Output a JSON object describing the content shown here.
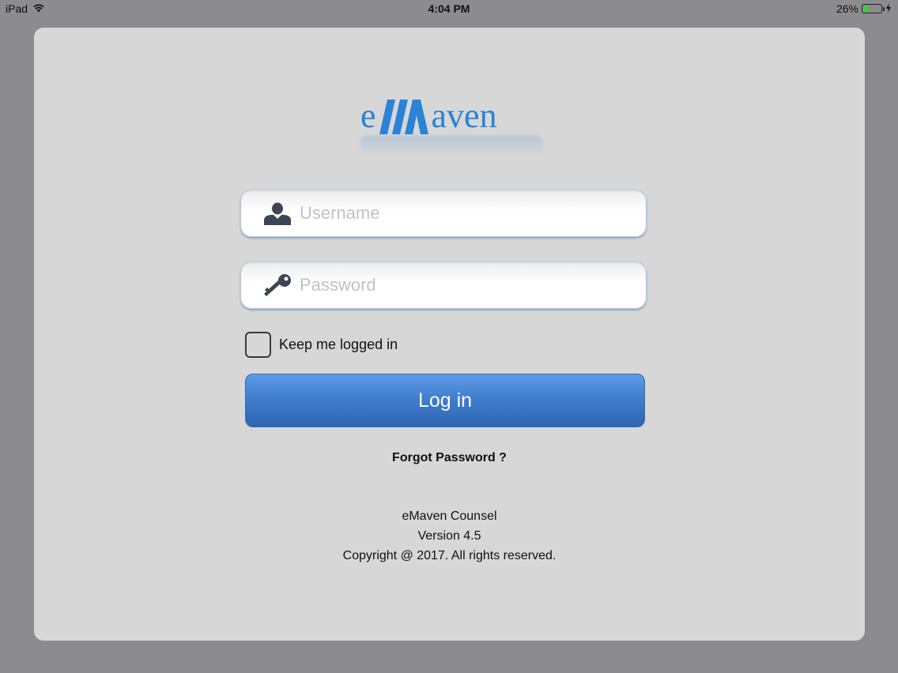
{
  "status_bar": {
    "device": "iPad",
    "time": "4:04 PM",
    "battery": "26%",
    "battery_level": 0.26
  },
  "logo": {
    "prefix": "e",
    "suffix": "aven"
  },
  "login_form": {
    "username_placeholder": "Username",
    "password_placeholder": "Password",
    "keep_logged_in_label": "Keep me logged in",
    "login_button_label": "Log in",
    "forgot_password_label": "Forgot Password ?"
  },
  "footer": {
    "app_name": "eMaven Counsel",
    "version": "Version 4.5",
    "copyright": "Copyright @ 2017. All rights reserved."
  },
  "colors": {
    "accent": "#2a83d6",
    "button": "#3f7bcc",
    "background": "#d7d7d7"
  }
}
